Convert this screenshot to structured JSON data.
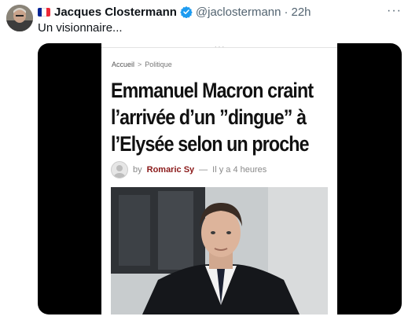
{
  "tweet": {
    "author_name": "Jacques Clostermann",
    "handle": "@jaclostermann",
    "separator": "·",
    "time": "22h",
    "more_label": "···",
    "text": "Un visionnaire...",
    "verified_color": "#1d9bf0",
    "flag_colors": [
      "#002395",
      "#ffffff",
      "#ed2939"
    ]
  },
  "article": {
    "top_dots": "···",
    "breadcrumb": [
      "Accueil",
      "Politique"
    ],
    "breadcrumb_sep": ">",
    "headline": "Emmanuel Macron craint l’arrivée d’un ”dingue” à l’Elysée selon un proche",
    "by_label": "by",
    "author": "Romaric Sy",
    "dash": "—",
    "time_ago": "Il y a 4 heures",
    "author_color": "#8b1a1a"
  }
}
